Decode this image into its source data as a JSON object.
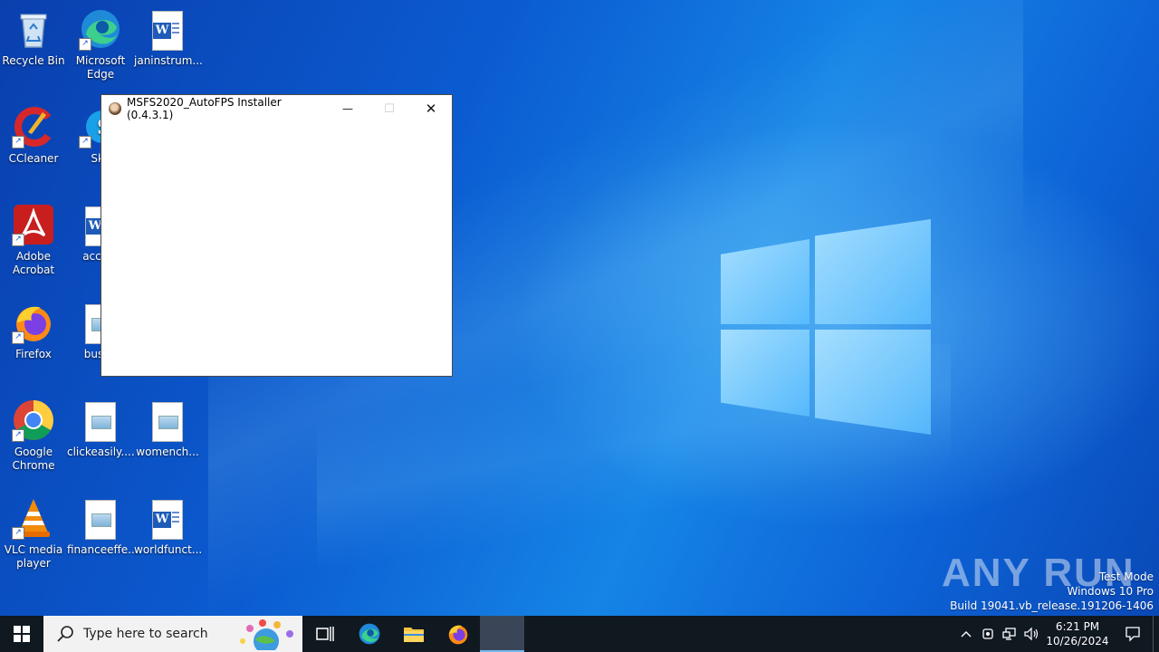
{
  "desktop": {
    "icons": [
      {
        "label": "Recycle Bin"
      },
      {
        "label": "Microsoft Edge"
      },
      {
        "label": "janinstrum..."
      },
      {
        "label": "CCleaner"
      },
      {
        "label": "Sky"
      },
      {
        "label": "Adobe Acrobat"
      },
      {
        "label": "accom"
      },
      {
        "label": "Firefox"
      },
      {
        "label": "bushe"
      },
      {
        "label": "Google Chrome"
      },
      {
        "label": "clickeasily...."
      },
      {
        "label": "womench..."
      },
      {
        "label": "VLC media player"
      },
      {
        "label": "financeeffe..."
      },
      {
        "label": "worldfunct..."
      }
    ]
  },
  "window": {
    "title": "MSFS2020_AutoFPS Installer (0.4.3.1)",
    "minimize": "—",
    "maximize": "☐",
    "close": "✕"
  },
  "watermark": {
    "brand": "ANY RUN",
    "line1": "Test Mode",
    "line2": "Windows 10 Pro",
    "line3": "Build 19041.vb_release.191206-1406"
  },
  "taskbar": {
    "search_placeholder": "Type here to search",
    "time": "6:21 PM",
    "date": "10/26/2024"
  },
  "colors": {
    "taskbar_bg": "#101820",
    "desktop_blue": "#0b5bd0",
    "active_indicator": "#76b9ed"
  }
}
